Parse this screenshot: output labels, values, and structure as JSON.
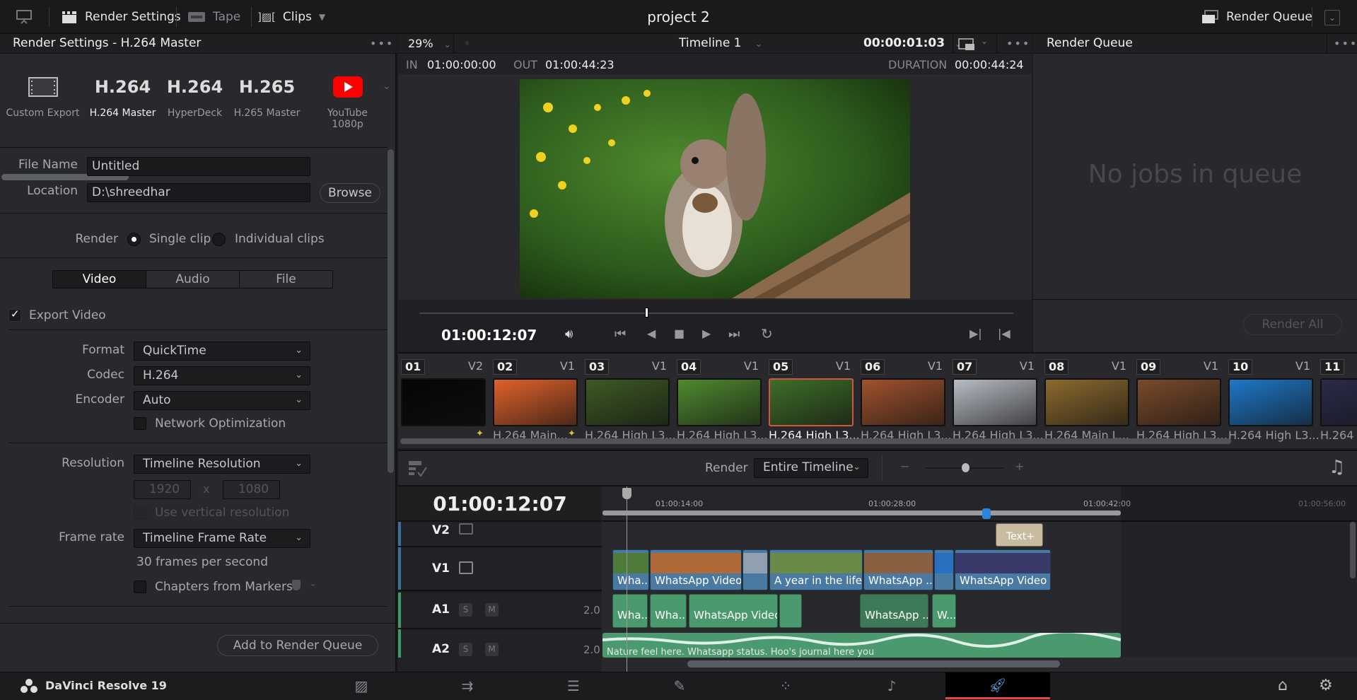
{
  "topbar": {
    "render_settings": "Render Settings",
    "tape": "Tape",
    "clips": "Clips",
    "project_title": "project 2",
    "render_queue": "Render Queue"
  },
  "render_settings": {
    "panel_title": "Render Settings - H.264 Master",
    "presets": [
      {
        "icon": "film-icon",
        "big": "",
        "label": "Custom Export"
      },
      {
        "icon": "",
        "big": "H.264",
        "label": "H.264 Master"
      },
      {
        "icon": "",
        "big": "H.264",
        "label": "HyperDeck"
      },
      {
        "icon": "",
        "big": "H.265",
        "label": "H.265 Master"
      },
      {
        "icon": "youtube-icon",
        "big": "",
        "label": "YouTube 1080p"
      }
    ],
    "selected_preset": "H.264 Master",
    "file_name_label": "File Name",
    "file_name": "Untitled",
    "location_label": "Location",
    "location": "D:\\shreedhar",
    "browse": "Browse",
    "render_label": "Render",
    "render_options": [
      "Single clip",
      "Individual clips"
    ],
    "render_selected": "Single clip",
    "tabs": [
      "Video",
      "Audio",
      "File"
    ],
    "active_tab": "Video",
    "export_video": "Export Video",
    "export_video_checked": true,
    "format_label": "Format",
    "format": "QuickTime",
    "codec_label": "Codec",
    "codec": "H.264",
    "encoder_label": "Encoder",
    "encoder": "Auto",
    "network_optimization": "Network Optimization",
    "resolution_label": "Resolution",
    "resolution": "Timeline Resolution",
    "width": "1920",
    "x": "x",
    "height": "1080",
    "use_vertical": "Use vertical resolution",
    "frame_rate_label": "Frame rate",
    "frame_rate": "Timeline Frame Rate",
    "fps_text": "30 frames per second",
    "chapters": "Chapters from Markers",
    "add_to_queue": "Add to Render Queue"
  },
  "viewer": {
    "zoom": "29%",
    "timeline_name": "Timeline 1",
    "timecode_top": "00:00:01:03",
    "in_label": "IN",
    "in_value": "01:00:00:00",
    "out_label": "OUT",
    "out_value": "01:00:44:23",
    "duration_label": "DURATION",
    "duration_value": "00:00:44:24",
    "current_timecode": "01:00:12:07",
    "scrub_position": 0.38
  },
  "render_queue": {
    "title": "Render Queue",
    "empty": "No jobs in queue",
    "render_all": "Render All"
  },
  "clips": [
    {
      "num": "01",
      "track": "V2",
      "caption": "",
      "color": "#050505",
      "fx": true
    },
    {
      "num": "02",
      "track": "V1",
      "caption": "H.264 Main...",
      "color": "#e0622a",
      "fx": true
    },
    {
      "num": "03",
      "track": "V1",
      "caption": "H.264 High L3...",
      "color": "#3d5a24"
    },
    {
      "num": "04",
      "track": "V1",
      "caption": "H.264 High L3...",
      "color": "#4f8a2e"
    },
    {
      "num": "05",
      "track": "V1",
      "caption": "H.264 High L3...",
      "color": "#3e6e28",
      "selected": true
    },
    {
      "num": "06",
      "track": "V1",
      "caption": "H.264 High L3...",
      "color": "#a0522d"
    },
    {
      "num": "07",
      "track": "V1",
      "caption": "H.264 High L3...",
      "color": "#b8bcc4"
    },
    {
      "num": "08",
      "track": "V1",
      "caption": "H.264 Main L...",
      "color": "#8c6a2e"
    },
    {
      "num": "09",
      "track": "V1",
      "caption": "H.264 High L3...",
      "color": "#7a4a2a"
    },
    {
      "num": "10",
      "track": "V1",
      "caption": "H.264 High L3...",
      "color": "#1e78c8"
    },
    {
      "num": "11",
      "track": "",
      "caption": "H.264",
      "color": "#2a2a4a"
    }
  ],
  "timeline": {
    "render_label": "Render",
    "render_range": "Entire Timeline",
    "timecode": "01:00:12:07",
    "ruler": [
      "01:00:14:00",
      "01:00:28:00",
      "01:00:42:00",
      "01:00:56:00"
    ],
    "tracks": [
      {
        "name": "V2"
      },
      {
        "name": "V1"
      },
      {
        "name": "A1",
        "level": "2.0",
        "s": "S",
        "m": "M"
      },
      {
        "name": "A2",
        "level": "2.0",
        "s": "S",
        "m": "M"
      }
    ],
    "v2_clips": [
      {
        "label": "Text+"
      }
    ],
    "v1_clips": [
      {
        "label": "Wha..."
      },
      {
        "label": "WhatsApp Video..."
      },
      {
        "label": ""
      },
      {
        "label": "A year in the life ..."
      },
      {
        "label": "WhatsApp ..."
      },
      {
        "label": ""
      },
      {
        "label": "WhatsApp Video ..."
      }
    ],
    "a1_clips": [
      {
        "label": "Wha..."
      },
      {
        "label": "Wha..."
      },
      {
        "label": "WhatsApp Video..."
      },
      {
        "label": ""
      },
      {
        "label": "WhatsApp ..."
      },
      {
        "label": "W..."
      }
    ],
    "a2_label": "Nature feel here. Whatsapp status. Hoo's journal here you"
  },
  "pagebar": {
    "app_name": "DaVinci Resolve 19",
    "pages": [
      "media-page-icon",
      "cut-page-icon",
      "edit-page-icon",
      "fusion-page-icon",
      "color-page-icon",
      "fairlight-page-icon",
      "deliver-page-icon"
    ],
    "active_page": "deliver-page-icon"
  }
}
